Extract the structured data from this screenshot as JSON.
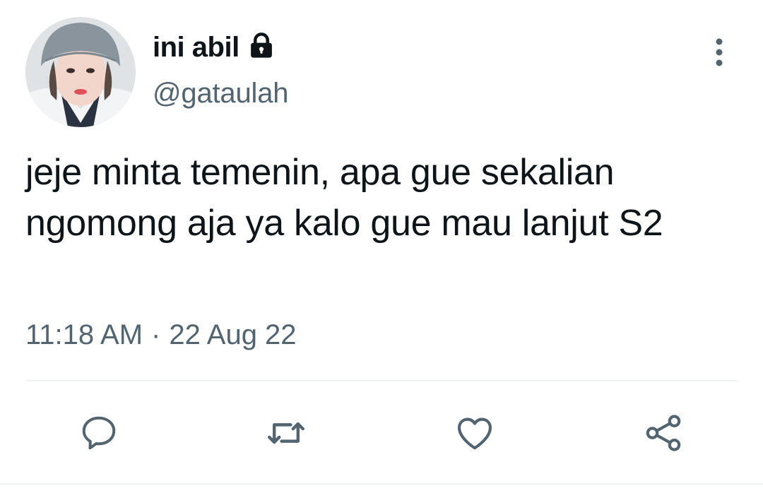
{
  "user": {
    "display_name": "ini abil",
    "handle": "@gataulah",
    "protected_icon": "lock-icon",
    "avatar": "profile-photo"
  },
  "tweet": {
    "text": "jeje minta temenin, apa gue sekalian ngomong aja ya kalo gue mau lanjut S2",
    "time": "11:18 AM",
    "separator": "·",
    "date": "22 Aug 22"
  },
  "actions": [
    {
      "name": "reply",
      "icon": "comment-icon"
    },
    {
      "name": "retweet",
      "icon": "retweet-icon"
    },
    {
      "name": "like",
      "icon": "heart-icon"
    },
    {
      "name": "share",
      "icon": "share-icon"
    }
  ],
  "menu": {
    "icon": "more-vertical-icon"
  },
  "colors": {
    "text": "#0f1419",
    "secondary": "#536471",
    "divider": "#eff3f4",
    "icon": "#536471"
  }
}
